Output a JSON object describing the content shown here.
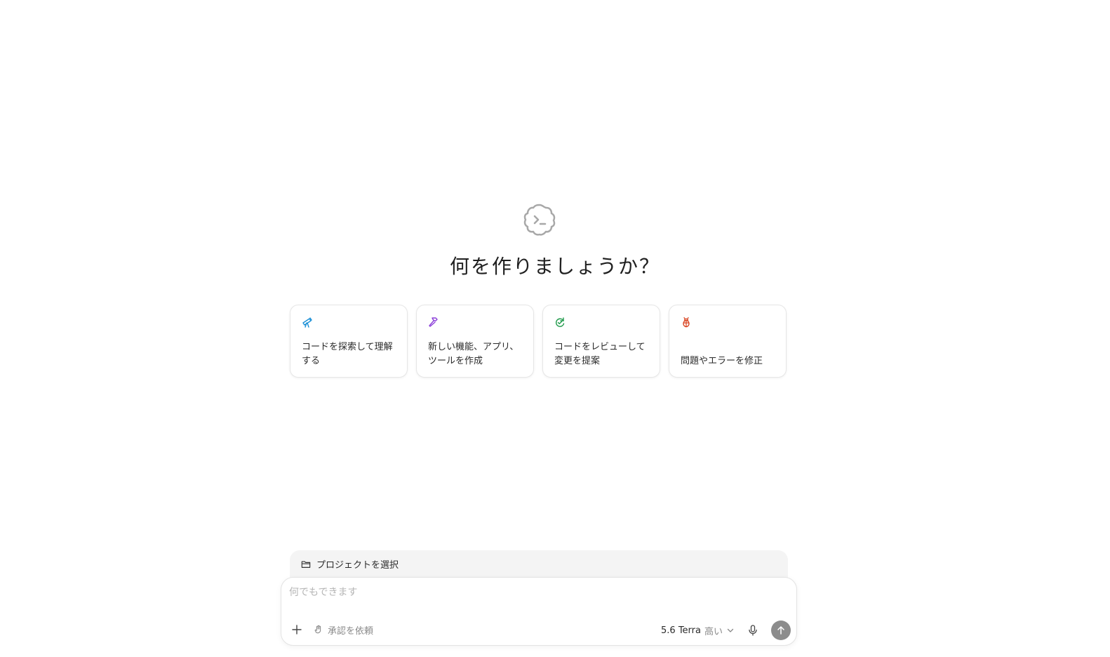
{
  "hero": {
    "logo_icon": "terminal-cloud-icon",
    "title": "何を作りましょうか？"
  },
  "suggestions": [
    {
      "label": "コードを探索して理解する",
      "icon": "telescope-icon",
      "color": "#1a8fd6"
    },
    {
      "label": "新しい機能、アプリ、ツールを作成",
      "icon": "hammer-icon",
      "color": "#8b3fd9"
    },
    {
      "label": "コードをレビューして変更を提案",
      "icon": "review-icon",
      "color": "#1f9a4a"
    },
    {
      "label": "問題やエラーを修正",
      "icon": "bug-icon",
      "color": "#d9421f"
    }
  ],
  "project": {
    "label": "プロジェクトを選択",
    "icon": "folder-icon"
  },
  "composer": {
    "placeholder": "何でもできます",
    "value": "",
    "approval_label": "承認を依頼",
    "model_name": "5.6 Terra",
    "model_effort": "高い"
  },
  "colors": {
    "send_button": "#8c8c8c",
    "logo": "#a8a8a8",
    "project_bar_bg": "#f4f4f4"
  }
}
